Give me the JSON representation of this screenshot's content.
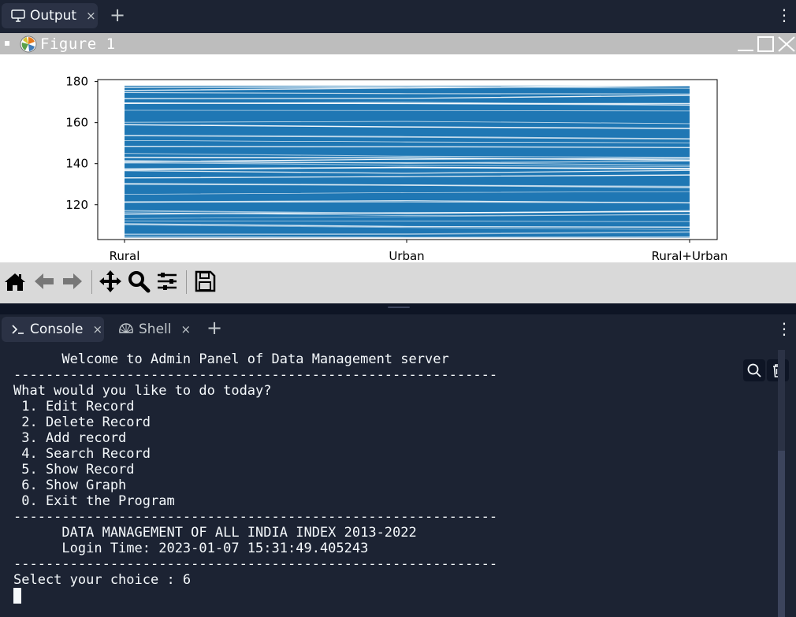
{
  "top_tabs": {
    "output_label": "Output",
    "close_glyph": "×",
    "add_glyph": "+",
    "menu_glyph": "⋮"
  },
  "figure_window": {
    "title": "Figure 1",
    "logo_icon": "matplotlib-logo-icon",
    "window_buttons": [
      "minimize-icon",
      "maximize-icon",
      "close-icon"
    ],
    "toolbar_icons": [
      "home-icon",
      "back-arrow-icon",
      "forward-arrow-icon",
      "pan-move-icon",
      "zoom-magnifier-icon",
      "configure-subplots-icon",
      "save-disk-icon"
    ]
  },
  "chart_data": {
    "type": "line",
    "categories": [
      "Rural",
      "Urban",
      "Rural+Urban"
    ],
    "y_ticks": [
      120,
      140,
      160,
      180
    ],
    "ylim": [
      103,
      181
    ],
    "line_color": "#1f77b4",
    "title": "",
    "xlabel": "",
    "ylabel": "",
    "grid": false,
    "series_description_values": {
      "min": 104,
      "max": 178
    }
  },
  "bottom_tabs": {
    "console_label": "Console",
    "shell_label": "Shell",
    "close_glyph": "×",
    "add_glyph": "+",
    "menu_glyph": "⋮"
  },
  "console": {
    "lines": [
      "      Welcome to Admin Panel of Data Management server",
      "------------------------------------------------------------",
      "What would you like to do today?",
      " 1. Edit Record",
      " 2. Delete Record",
      " 3. Add record",
      " 4. Search Record",
      " 5. Show Record",
      " 6. Show Graph",
      " 0. Exit the Program",
      "------------------------------------------------------------",
      "      DATA MANAGEMENT OF ALL INDIA INDEX 2013-2022",
      "      Login Time: 2023-01-07 15:31:49.405243",
      "------------------------------------------------------------",
      "Select your choice : 6"
    ],
    "tools": [
      "search-icon",
      "trash-icon"
    ]
  }
}
